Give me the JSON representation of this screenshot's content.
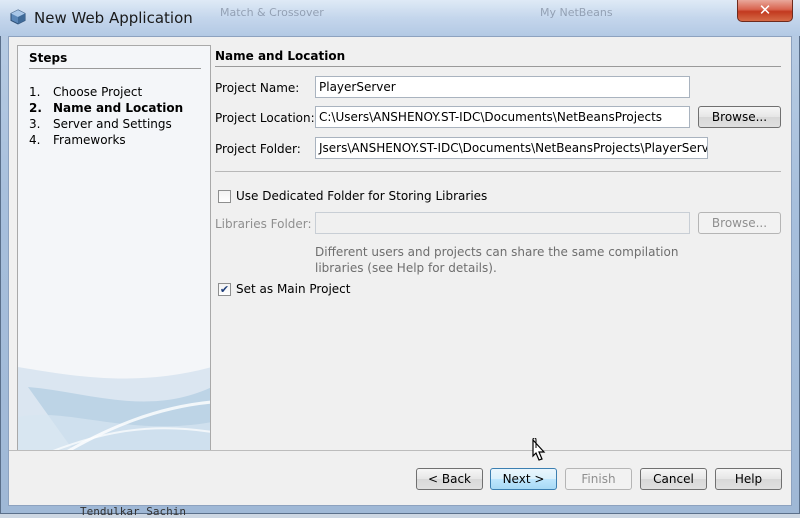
{
  "window": {
    "title": "New Web Application",
    "close_glyph": "✕",
    "background_tabs": [
      "Match & Crossover",
      "My NetBeans"
    ],
    "underlying_text": "Tendulkar   Sachin"
  },
  "steps": {
    "heading": "Steps",
    "items": [
      {
        "num": "1.",
        "label": "Choose Project",
        "active": false
      },
      {
        "num": "2.",
        "label": "Name and Location",
        "active": true
      },
      {
        "num": "3.",
        "label": "Server and Settings",
        "active": false
      },
      {
        "num": "4.",
        "label": "Frameworks",
        "active": false
      }
    ]
  },
  "form": {
    "heading": "Name and Location",
    "project_name_label": "Project Name:",
    "project_name_value": "PlayerServer",
    "project_location_label": "Project Location:",
    "project_location_value": "C:\\Users\\ANSHENOY.ST-IDC\\Documents\\NetBeansProjects",
    "browse_label": "Browse...",
    "project_folder_label": "Project Folder:",
    "project_folder_value": "Jsers\\ANSHENOY.ST-IDC\\Documents\\NetBeansProjects\\PlayerServer",
    "dedicated_folder_label": "Use Dedicated Folder for Storing Libraries",
    "dedicated_folder_checked": false,
    "libraries_folder_label": "Libraries Folder:",
    "libraries_folder_value": "",
    "libraries_browse_label": "Browse...",
    "hint_line1": "Different users and projects can share the same compilation",
    "hint_line2": "libraries (see Help for details).",
    "main_project_label": "Set as Main Project",
    "main_project_checked": true
  },
  "buttons": {
    "back": "< Back",
    "next": "Next >",
    "finish": "Finish",
    "cancel": "Cancel",
    "help": "Help"
  },
  "colors": {
    "title_bar": "#c4d6ec",
    "close_button": "#c2391f",
    "focused_button": "#3c7fb1",
    "panel_background": "#f0f0f0"
  }
}
